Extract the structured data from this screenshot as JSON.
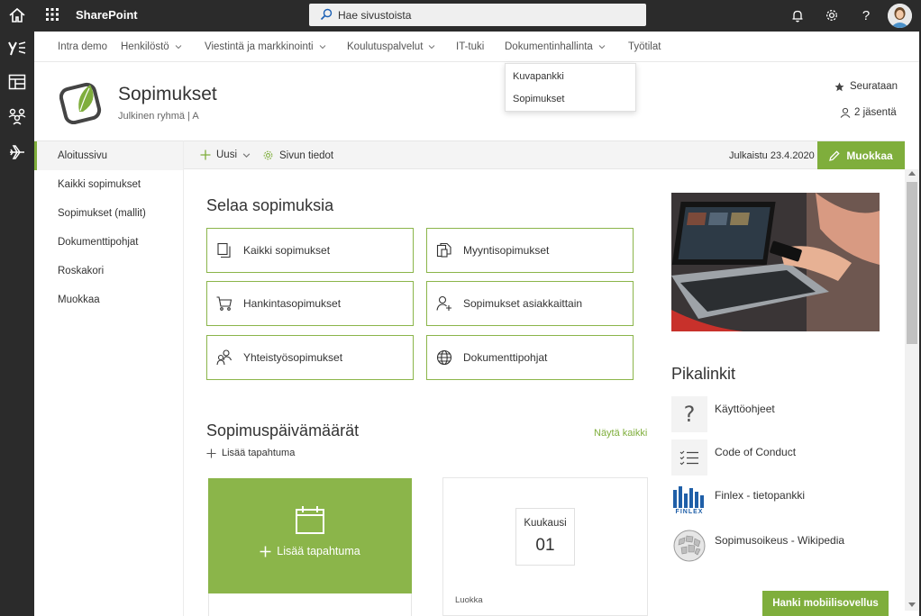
{
  "suite": {
    "app_name": "SharePoint",
    "search_placeholder": "Hae sivustoista"
  },
  "topnav": {
    "items": [
      {
        "label": "Intra demo",
        "has_menu": false
      },
      {
        "label": "Henkilöstö",
        "has_menu": true
      },
      {
        "label": "Viestintä ja markkinointi",
        "has_menu": true
      },
      {
        "label": "Koulutuspalvelut",
        "has_menu": true
      },
      {
        "label": "IT-tuki",
        "has_menu": false
      },
      {
        "label": "Dokumentinhallinta",
        "has_menu": true
      },
      {
        "label": "Työtilat",
        "has_menu": false
      }
    ],
    "dropdown": [
      "Kuvapankki",
      "Sopimukset"
    ]
  },
  "site": {
    "title": "Sopimukset",
    "subtitle": "Julkinen ryhmä | A",
    "follow_label": "Seurataan",
    "members_label": "2 jäsentä"
  },
  "commandbar": {
    "new_label": "Uusi",
    "page_details_label": "Sivun tiedot",
    "published": "Julkaistu 23.4.2020",
    "edit_label": "Muokkaa"
  },
  "leftnav": {
    "items": [
      "Aloitussivu",
      "Kaikki sopimukset",
      "Sopimukset (mallit)",
      "Dokumenttipohjat",
      "Roskakori",
      "Muokkaa"
    ]
  },
  "browse": {
    "title": "Selaa sopimuksia",
    "tiles": [
      {
        "label": "Kaikki sopimukset",
        "icon": "copy-icon"
      },
      {
        "label": "Myyntisopimukset",
        "icon": "documents-icon"
      },
      {
        "label": "Hankintasopimukset",
        "icon": "cart-icon"
      },
      {
        "label": "Sopimukset asiakkaittain",
        "icon": "add-person-icon"
      },
      {
        "label": "Yhteistyösopimukset",
        "icon": "people-icon"
      },
      {
        "label": "Dokumenttipohjat",
        "icon": "globe-icon"
      }
    ]
  },
  "events": {
    "title": "Sopimuspäivämäärät",
    "show_all": "Näytä kaikki",
    "add_event_link": "Lisää tapahtuma",
    "add_event_card": "Lisää tapahtuma",
    "month_label": "Kuukausi",
    "month_day": "01",
    "category_label": "Luokka"
  },
  "quicklinks": {
    "title": "Pikalinkit",
    "items": [
      {
        "label": "Käyttöohjeet",
        "icon": "question-icon"
      },
      {
        "label": "Code of Conduct",
        "icon": "list-icon"
      },
      {
        "label": "Finlex - tietopankki",
        "icon": "finlex-logo"
      },
      {
        "label": "Sopimusoikeus - Wikipedia",
        "icon": "wikipedia-logo"
      }
    ],
    "finlex_logo_text": "FINLEX"
  },
  "mobile_button": "Hanki mobiilisovellus",
  "colors": {
    "accent": "#7fae3c",
    "tile_border": "#8bb54a",
    "dark_bar": "#2b2b2b"
  }
}
